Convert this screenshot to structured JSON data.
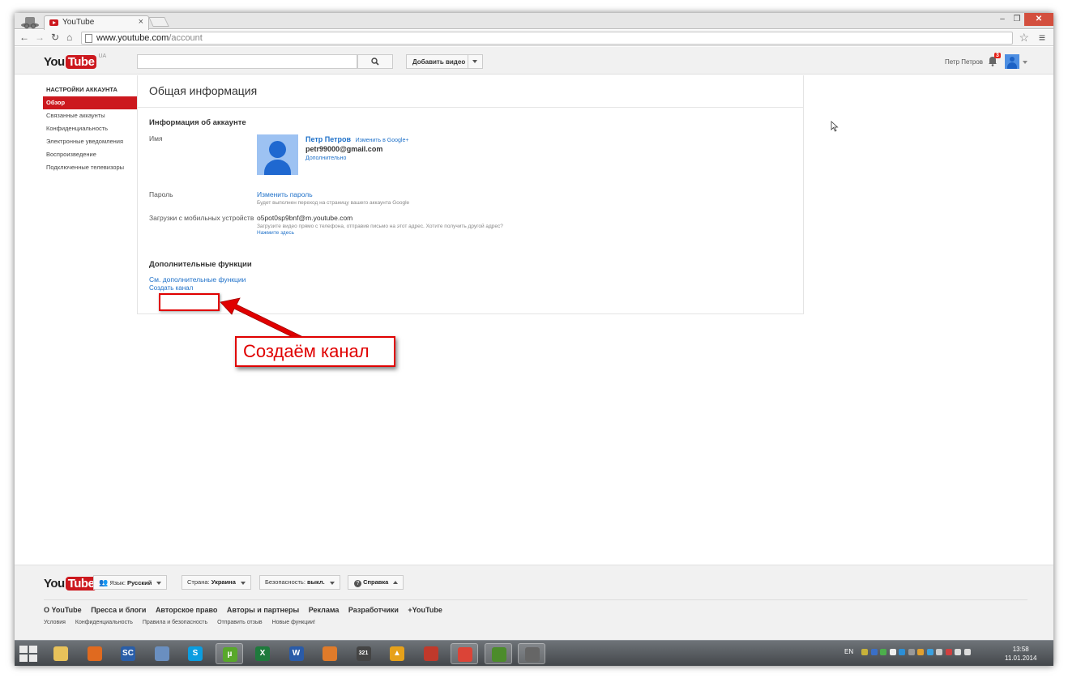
{
  "browser": {
    "tab_title": "YouTube",
    "tab_close": "×",
    "url_host": "www.youtube.com",
    "url_path": "/account"
  },
  "header": {
    "logo_you": "You",
    "logo_tube": "Tube",
    "region": "UA",
    "upload_label": "Добавить видео",
    "user_name": "Петр Петров",
    "notification_count": "3"
  },
  "sidebar": {
    "title": "НАСТРОЙКИ АККАУНТА",
    "items": [
      {
        "label": "Обзор"
      },
      {
        "label": "Связанные аккаунты"
      },
      {
        "label": "Конфиденциальность"
      },
      {
        "label": "Электронные уведомления"
      },
      {
        "label": "Воспроизведение"
      },
      {
        "label": "Подключенные телевизоры"
      }
    ]
  },
  "main": {
    "title": "Общая информация",
    "account_section": "Информация об аккаунте",
    "name_label": "Имя",
    "display_name": "Петр Петров",
    "edit_google": "Изменить в Google+",
    "email": "petr99000@gmail.com",
    "more": "Дополнительно",
    "password_label": "Пароль",
    "change_password": "Изменить пароль",
    "password_note": "Будет выполнен переход на страницу вашего аккаунта Google",
    "mobile_label": "Загрузки с мобильных устройств",
    "mobile_email": "o5pot0sp9bnf@m.youtube.com",
    "mobile_note": "Загрузите видео прямо с телефона, отправив письмо на этот адрес. Хотите получить другой адрес?",
    "click_here": "Нажмите здесь",
    "extra_section": "Дополнительные функции",
    "see_extra": "См. дополнительные функции",
    "create_channel": "Создать канал"
  },
  "annotation": {
    "callout": "Создаём канал",
    "color": "#e00000"
  },
  "footer": {
    "language_label": "Язык:",
    "language_value": "Русский",
    "country_label": "Страна:",
    "country_value": "Украина",
    "safety_label": "Безопасность:",
    "safety_value": "выкл.",
    "help": "Справка",
    "links_main": [
      "О YouTube",
      "Пресса и блоги",
      "Авторское право",
      "Авторы и партнеры",
      "Реклама",
      "Разработчики",
      "+YouTube"
    ],
    "links_secondary": [
      "Условия",
      "Конфиденциальность",
      "Правила и безопасность",
      "Отправить отзыв",
      "Новые функции!"
    ]
  },
  "taskbar": {
    "apps": [
      {
        "name": "explorer",
        "glyph": "",
        "color": "#e8c25a"
      },
      {
        "name": "pen-tool",
        "glyph": "",
        "color": "#e06a1f"
      },
      {
        "name": "screen-capture",
        "glyph": "SC",
        "color": "#2a5ea8"
      },
      {
        "name": "network-tool",
        "glyph": "",
        "color": "#6a8fc0"
      },
      {
        "name": "skype",
        "glyph": "S",
        "color": "#0b9de0"
      },
      {
        "name": "utorrent",
        "glyph": "µ",
        "color": "#58a82a"
      },
      {
        "name": "excel",
        "glyph": "X",
        "color": "#1e7a3c"
      },
      {
        "name": "word",
        "glyph": "W",
        "color": "#2a5ba8"
      },
      {
        "name": "faststone",
        "glyph": "",
        "color": "#e07b2a"
      },
      {
        "name": "calendar",
        "glyph": "321",
        "color": "#444444"
      },
      {
        "name": "aimp",
        "glyph": "▲",
        "color": "#e6a11a"
      },
      {
        "name": "disk-tool",
        "glyph": "",
        "color": "#c0392b"
      },
      {
        "name": "chrome",
        "glyph": "",
        "color": "#db4437"
      },
      {
        "name": "nvidia",
        "glyph": "",
        "color": "#4c8c2b"
      },
      {
        "name": "recorder",
        "glyph": "",
        "color": "#666666"
      }
    ],
    "language": "EN",
    "time": "13:58",
    "date": "11.01.2014"
  }
}
